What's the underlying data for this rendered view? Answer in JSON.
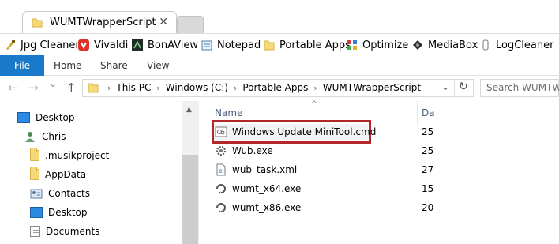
{
  "tab": {
    "title": "WUMTWrapperScript",
    "close": "✕"
  },
  "bookmarks": [
    {
      "label": "Jpg Cleaner",
      "icon": "jpg-cleaner-icon"
    },
    {
      "label": "Vivaldi",
      "icon": "vivaldi-icon"
    },
    {
      "label": "BonAView",
      "icon": "bonaview-icon"
    },
    {
      "label": "Notepad",
      "icon": "notepad-icon"
    },
    {
      "label": "Portable Apps",
      "icon": "folder-icon"
    },
    {
      "label": "Optimize",
      "icon": "optimize-icon"
    },
    {
      "label": "MediaBox",
      "icon": "mediabox-icon"
    },
    {
      "label": "LogCleaner",
      "icon": "logcleaner-icon"
    }
  ],
  "ribbon": {
    "file": "File",
    "home": "Home",
    "share": "Share",
    "view": "View"
  },
  "address": {
    "crumbs": [
      "This PC",
      "Windows (C:)",
      "Portable Apps",
      "WUMTWrapperScript"
    ],
    "search_placeholder": "Search WUMTWra"
  },
  "nav": {
    "back": "←",
    "forward": "→",
    "dropdown": "⌄",
    "up": "↑",
    "refresh": "↻",
    "address_dropdown": "⌄"
  },
  "navpane": {
    "items": [
      {
        "label": "Desktop",
        "icon": "desktop-icon"
      },
      {
        "label": "Chris",
        "icon": "user-icon"
      },
      {
        "label": ".musikproject",
        "icon": "folder-icon"
      },
      {
        "label": "AppData",
        "icon": "folder-icon"
      },
      {
        "label": "Contacts",
        "icon": "contacts-icon"
      },
      {
        "label": "Desktop",
        "icon": "desktop-icon"
      },
      {
        "label": "Documents",
        "icon": "documents-icon"
      }
    ]
  },
  "filelist": {
    "columns": {
      "name": "Name",
      "date": "Da"
    },
    "files": [
      {
        "name": "Windows Update MiniTool.cmd",
        "date": "25",
        "icon": "cmd-file-icon"
      },
      {
        "name": "Wub.exe",
        "date": "25",
        "icon": "exe-gear-icon"
      },
      {
        "name": "wub_task.xml",
        "date": "27",
        "icon": "xml-file-icon"
      },
      {
        "name": "wumt_x64.exe",
        "date": "15",
        "icon": "wumt-exe-icon"
      },
      {
        "name": "wumt_x86.exe",
        "date": "20",
        "icon": "wumt-exe-icon"
      }
    ]
  },
  "colors": {
    "accent": "#1979ca",
    "highlight_border": "#b3262a",
    "folder": "#f6d977"
  }
}
